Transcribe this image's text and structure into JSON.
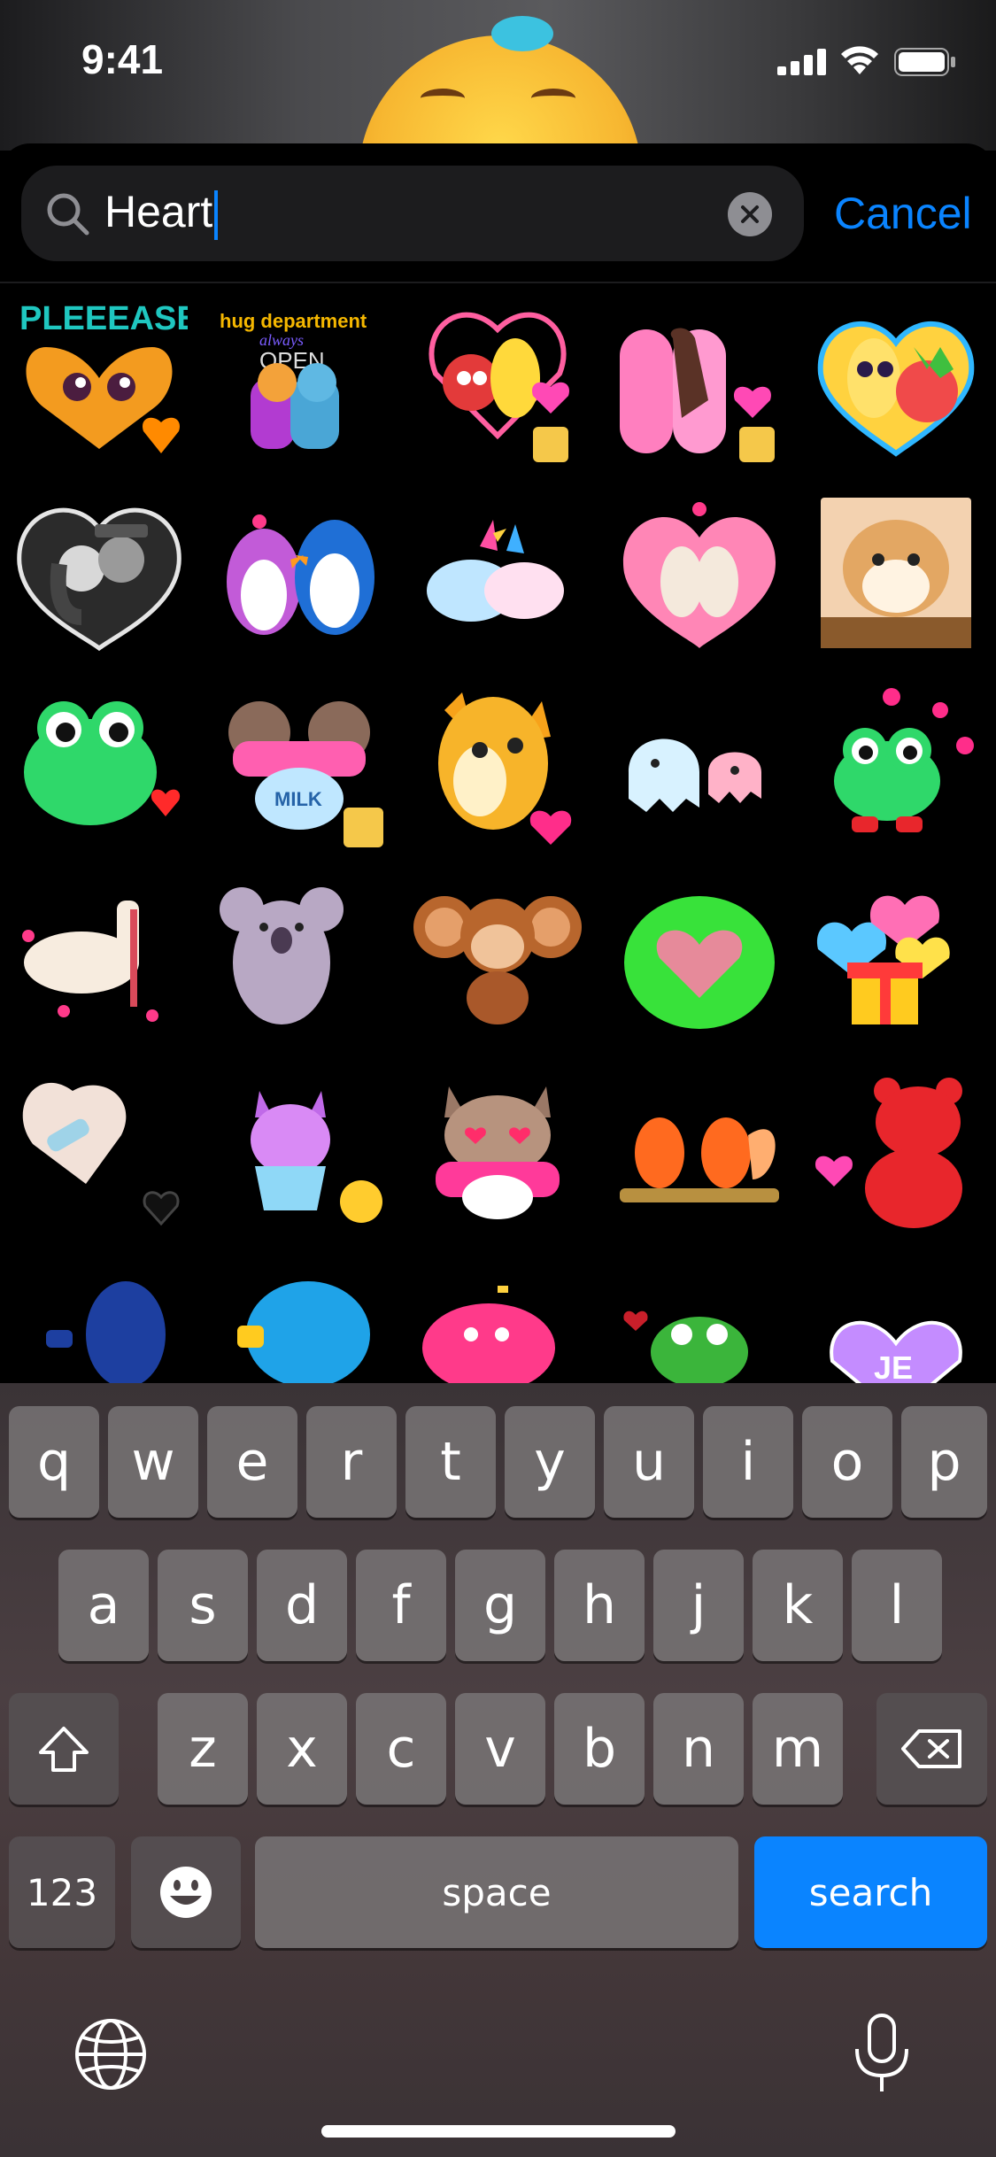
{
  "status_bar": {
    "time": "9:41"
  },
  "search": {
    "query": "Heart",
    "cancel_label": "Cancel"
  },
  "stickers": [
    {
      "name": "sticker-pleease-heart",
      "text": "PLEEEASE"
    },
    {
      "name": "sticker-hug-department",
      "text": "hug department always OPEN"
    },
    {
      "name": "sticker-fruit-couple-swing",
      "text": ""
    },
    {
      "name": "sticker-pink-chocolate-hug",
      "text": ""
    },
    {
      "name": "sticker-banana-strawberry-heart",
      "text": ""
    },
    {
      "name": "sticker-noir-couple-heart",
      "text": ""
    },
    {
      "name": "sticker-penguins-kiss",
      "text": ""
    },
    {
      "name": "sticker-unicorns-love",
      "text": ""
    },
    {
      "name": "sticker-alpacas-heart",
      "text": ""
    },
    {
      "name": "sticker-shiba-dog",
      "text": ""
    },
    {
      "name": "sticker-green-frog-heart",
      "text": ""
    },
    {
      "name": "sticker-cats-milk",
      "text": "MILK"
    },
    {
      "name": "sticker-fox-heart",
      "text": ""
    },
    {
      "name": "sticker-ghosts-kiss",
      "text": ""
    },
    {
      "name": "sticker-frog-hearts",
      "text": ""
    },
    {
      "name": "sticker-llama-hearts",
      "text": ""
    },
    {
      "name": "sticker-koala",
      "text": ""
    },
    {
      "name": "sticker-monkey",
      "text": ""
    },
    {
      "name": "sticker-green-heart-hands",
      "text": ""
    },
    {
      "name": "sticker-hearts-gift",
      "text": ""
    },
    {
      "name": "sticker-broken-heart-bandage",
      "text": ""
    },
    {
      "name": "sticker-cat-cupcake",
      "text": ""
    },
    {
      "name": "sticker-cat-heart-eyes",
      "text": ""
    },
    {
      "name": "sticker-squirrels-branch",
      "text": ""
    },
    {
      "name": "sticker-red-bear-heart",
      "text": ""
    },
    {
      "name": "sticker-blue-partial",
      "text": ""
    },
    {
      "name": "sticker-blue-monster-partial",
      "text": ""
    },
    {
      "name": "sticker-pink-creature-partial",
      "text": ""
    },
    {
      "name": "sticker-frog-partial",
      "text": ""
    },
    {
      "name": "sticker-purple-heart-partial",
      "text": "JE"
    }
  ],
  "keyboard": {
    "row1": [
      "q",
      "w",
      "e",
      "r",
      "t",
      "y",
      "u",
      "i",
      "o",
      "p"
    ],
    "row2": [
      "a",
      "s",
      "d",
      "f",
      "g",
      "h",
      "j",
      "k",
      "l"
    ],
    "row3": [
      "z",
      "x",
      "c",
      "v",
      "b",
      "n",
      "m"
    ],
    "numbers_label": "123",
    "space_label": "space",
    "search_label": "search"
  }
}
